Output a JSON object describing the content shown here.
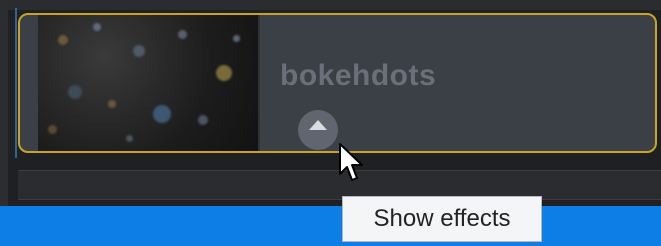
{
  "clip": {
    "title": "bokehdots",
    "thumbnail": "bokeh-particles-thumbnail",
    "selected_border_color": "#c9a227"
  },
  "expand_button": {
    "icon": "chevron-up-icon"
  },
  "tooltip": {
    "text": "Show effects"
  },
  "colors": {
    "status_bar": "#0c7ee6",
    "clip_background": "#3b4047",
    "app_background": "#1f2022"
  }
}
